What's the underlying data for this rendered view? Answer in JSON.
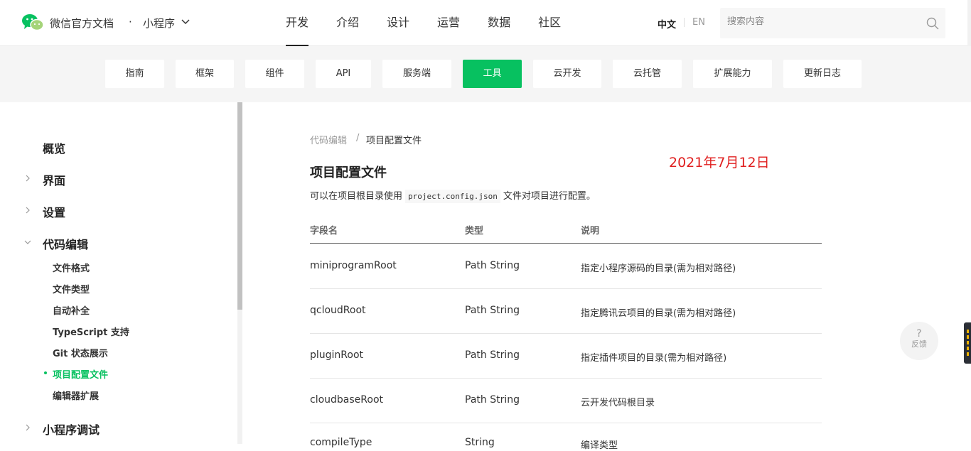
{
  "header": {
    "brand": "微信官方文档",
    "dot": "·",
    "product": "小程序",
    "nav": [
      "开发",
      "介绍",
      "设计",
      "运营",
      "数据",
      "社区"
    ],
    "active_nav": "开发",
    "lang_zh": "中文",
    "lang_en": "EN",
    "search_placeholder": "搜索内容"
  },
  "subnav": {
    "tabs": [
      "指南",
      "框架",
      "组件",
      "API",
      "服务端",
      "工具",
      "云开发",
      "云托管",
      "扩展能力",
      "更新日志"
    ],
    "active_tab": "工具",
    "accent": "#07c160"
  },
  "sidebar": {
    "sections": [
      "概览",
      "界面",
      "设置",
      "代码编辑",
      "小程序调试"
    ],
    "code_edit_items": [
      "文件格式",
      "文件类型",
      "自动补全",
      "TypeScript 支持",
      "Git 状态展示",
      "项目配置文件",
      "编辑器扩展"
    ],
    "active_item": "项目配置文件"
  },
  "main": {
    "breadcrumb": [
      "代码编辑",
      "项目配置文件"
    ],
    "breadcrumb_sep": "/",
    "date_note": "2021年7月12日",
    "title": "项目配置文件",
    "desc_before": "可以在项目根目录使用",
    "desc_code": "project.config.json",
    "desc_after": "文件对项目进行配置。",
    "table": {
      "headers": [
        "字段名",
        "类型",
        "说明"
      ],
      "rows": [
        [
          "miniprogramRoot",
          "Path String",
          "指定小程序源码的目录(需为相对路径)"
        ],
        [
          "qcloudRoot",
          "Path String",
          "指定腾讯云项目的目录(需为相对路径)"
        ],
        [
          "pluginRoot",
          "Path String",
          "指定插件项目的目录(需为相对路径)"
        ],
        [
          "cloudbaseRoot",
          "Path String",
          "云开发代码根目录"
        ],
        [
          "compileType",
          "String",
          "编译类型"
        ]
      ]
    }
  },
  "feedback": {
    "icon": "?",
    "label": "反馈"
  }
}
